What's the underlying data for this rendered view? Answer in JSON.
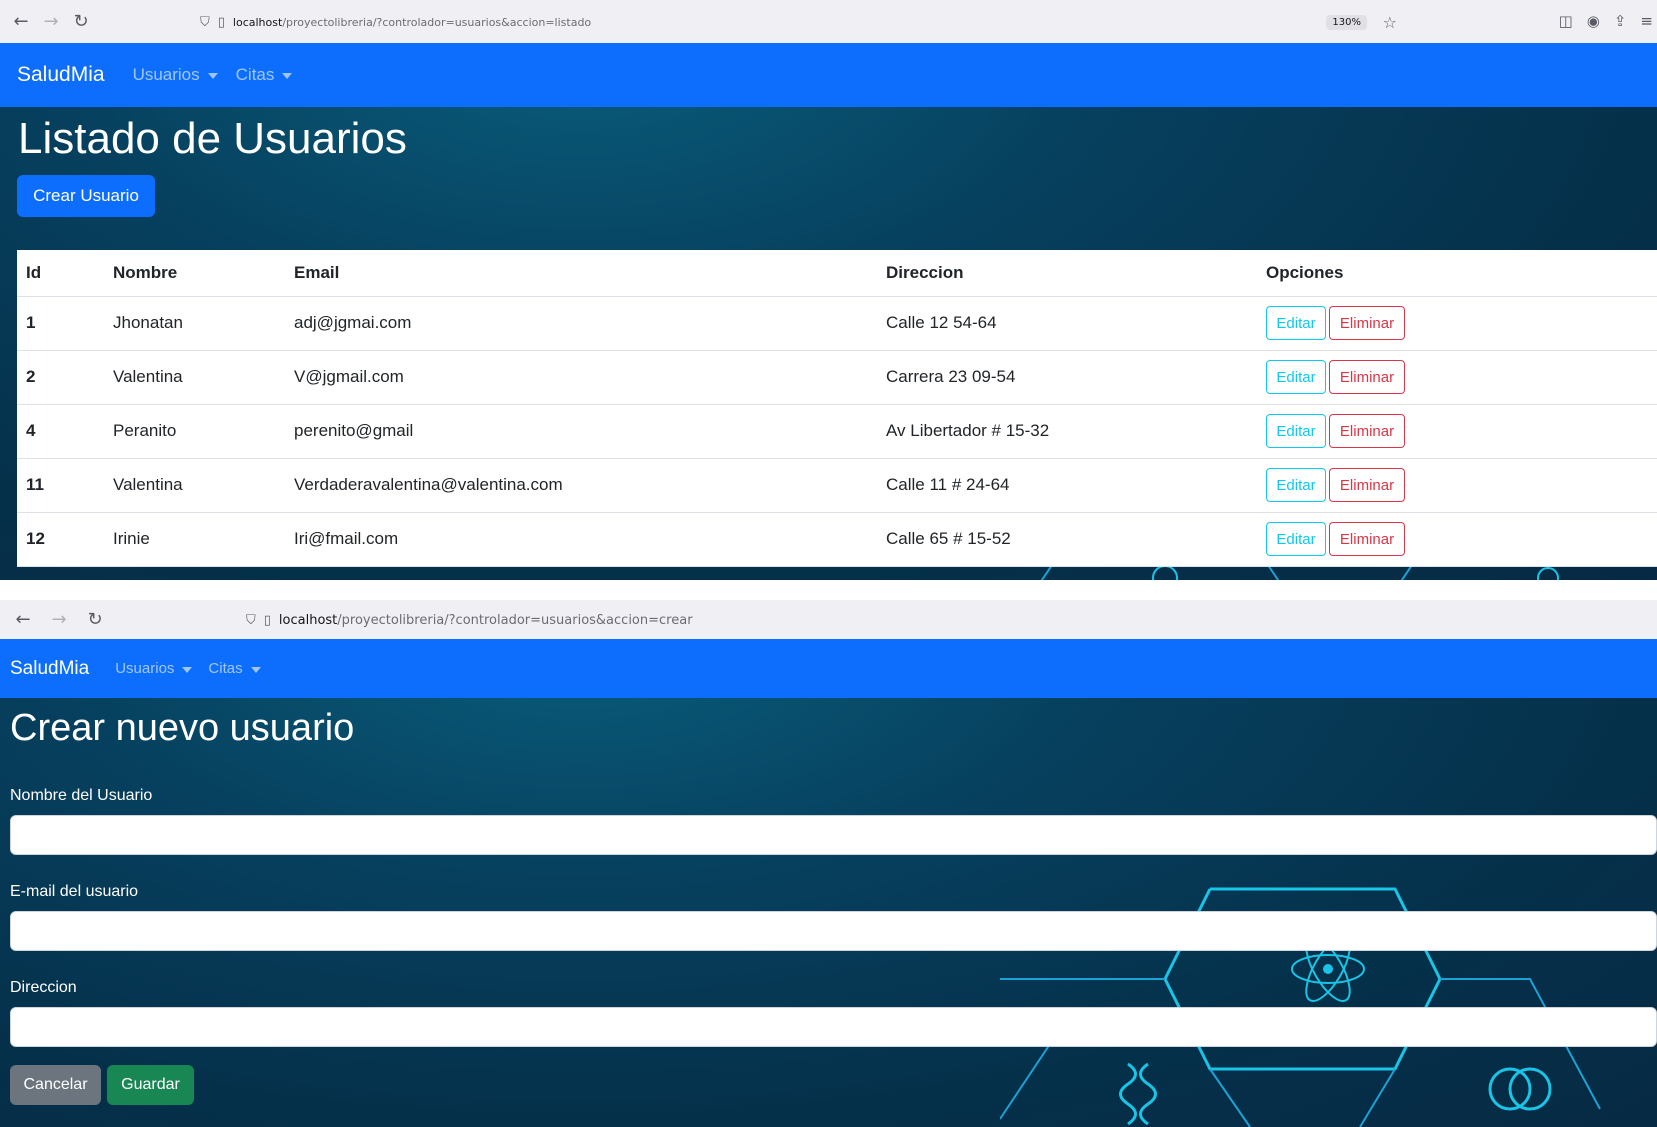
{
  "listado": {
    "browser": {
      "url_host": "localhost",
      "url_path": "/proyectolibreria/?controlador=usuarios&accion=listado",
      "zoom": "130%"
    },
    "navbar": {
      "brand": "SaludMia",
      "menus": [
        "Usuarios",
        "Citas"
      ]
    },
    "title": "Listado de Usuarios",
    "create_button": "Crear Usuario",
    "table": {
      "headers": [
        "Id",
        "Nombre",
        "Email",
        "Direccion",
        "Opciones"
      ],
      "rows": [
        {
          "id": "1",
          "nombre": "Jhonatan",
          "email": "adj@jgmai.com",
          "direccion": "Calle 12 54-64"
        },
        {
          "id": "2",
          "nombre": "Valentina",
          "email": "V@jgmail.com",
          "direccion": "Carrera 23 09-54"
        },
        {
          "id": "4",
          "nombre": "Peranito",
          "email": "perenito@gmail",
          "direccion": "Av Libertador # 15-32"
        },
        {
          "id": "11",
          "nombre": "Valentina",
          "email": "Verdaderavalentina@valentina.com",
          "direccion": "Calle 11 # 24-64"
        },
        {
          "id": "12",
          "nombre": "Irinie",
          "email": "Iri@fmail.com",
          "direccion": "Calle 65 # 15-52"
        }
      ],
      "edit_label": "Editar",
      "delete_label": "Eliminar"
    }
  },
  "crear": {
    "browser": {
      "url_host": "localhost",
      "url_path": "/proyectolibreria/?controlador=usuarios&accion=crear"
    },
    "navbar": {
      "brand": "SaludMia",
      "menus": [
        "Usuarios",
        "Citas"
      ]
    },
    "title": "Crear nuevo usuario",
    "fields": [
      {
        "label": "Nombre del Usuario",
        "value": ""
      },
      {
        "label": "E-mail del usuario",
        "value": ""
      },
      {
        "label": "Direccion",
        "value": ""
      }
    ],
    "cancel_button": "Cancelar",
    "save_button": "Guardar"
  },
  "colors": {
    "primary": "#0d6efd",
    "info": "#0dcaf0",
    "danger": "#dc3545",
    "secondary": "#6c757d",
    "success": "#198754",
    "background": "#05304a"
  }
}
